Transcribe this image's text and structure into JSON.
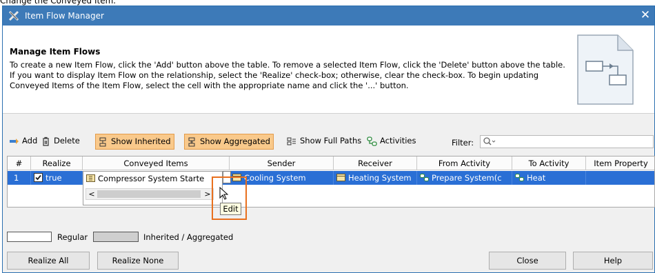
{
  "caption": "Change the Conveyed Item.",
  "window": {
    "title": "Item Flow Manager",
    "close_glyph": "✕"
  },
  "header": {
    "heading": "Manage Item Flows",
    "description": "To create a new Item Flow, click the 'Add' button above the table. To remove a selected Item Flow, click the 'Delete' button above the table. If you want to display Item Flow on the relationship, select the 'Realize' check-box; otherwise, clear the check-box. To begin updating Conveyed Items of the Item Flow, select the cell with the appropriate name and click the '...' button."
  },
  "toolbar": {
    "add": "Add",
    "delete": "Delete",
    "show_inherited": "Show Inherited",
    "show_aggregated": "Show Aggregated",
    "show_full_paths": "Show Full Paths",
    "activities": "Activities",
    "filter_label": "Filter:",
    "filter_value": ""
  },
  "table": {
    "columns": [
      "#",
      "Realize",
      "Conveyed Items",
      "Sender",
      "Receiver",
      "From Activity",
      "To Activity",
      "Item Property"
    ],
    "row": {
      "num": "1",
      "realize": "true",
      "conveyed": "Compressor System Starte",
      "sender": "Cooling System",
      "receiver": "Heating System",
      "from_activity": "Prepare System(c",
      "to_activity": "Heat",
      "item_property": ""
    },
    "edit_button": "...",
    "scroll_left": "<",
    "scroll_right": ">",
    "tooltip": "Edit"
  },
  "legend": {
    "regular": "Regular",
    "inherited": "Inherited / Aggregated"
  },
  "buttons": {
    "realize_all": "Realize All",
    "realize_none": "Realize None",
    "close": "Close",
    "help": "Help"
  },
  "colors": {
    "titlebar": "#3d7ab8",
    "selected_row": "#2a6fd5",
    "toggle_bg": "#f9c98b",
    "highlight": "#e86f1d"
  }
}
